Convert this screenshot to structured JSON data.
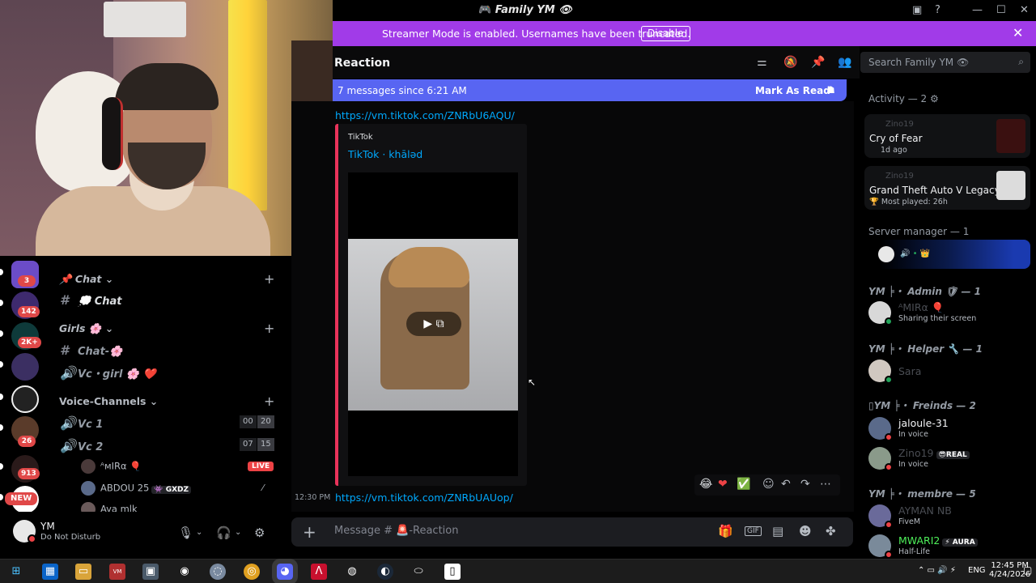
{
  "window": {
    "title": "Family YM",
    "title_icon": "gamepad-emoji"
  },
  "streamer": {
    "message": "Streamer Mode is enabled. Usernames have been truncated.",
    "button": "Disable"
  },
  "channel_header": {
    "name": "Reaction",
    "search_placeholder": "Search Family YM 👁"
  },
  "new_messages": {
    "text": "7 messages since 6:21 AM",
    "mark_read": "Mark As Read"
  },
  "messages": [
    {
      "link": "https://vm.tiktok.com/ZNRbU6AQU/",
      "embed": {
        "provider": "TikTok",
        "title": "TikTok · khāləd"
      }
    },
    {
      "time": "12:30 PM",
      "link": "https://vm.tiktok.com/ZNRbUAUop/"
    }
  ],
  "reactions": [
    "😂",
    "❤️",
    "✅"
  ],
  "composer": {
    "placeholder": "Message # 🚨-Reaction"
  },
  "guild_badges": [
    "3",
    "142",
    "2K+",
    "26",
    "913",
    "NEW"
  ],
  "channels": {
    "cat_chat": "📌 Chat ⌄",
    "chat": "💭 Chat",
    "cat_girls": "Girls 🌸 ⌄",
    "chat_girls": "Chat-🌸",
    "vc_girl": "Vc・girl 🌸 ❤️",
    "cat_voice": "Voice-Channels ⌄",
    "vc1": "Vc 1",
    "vc1_count": [
      "00",
      "20"
    ],
    "vc2": "Vc 2",
    "vc2_count": [
      "07",
      "15"
    ],
    "users": [
      {
        "name": "ᴬᴍIRα 🎈 ",
        "live": "LIVE"
      },
      {
        "name": "ABDOU 25",
        "tag": "👾 GXDZ"
      },
      {
        "name": "Aya mlk"
      }
    ]
  },
  "user": {
    "name": "YM",
    "status": "Do Not Disturb"
  },
  "members": {
    "activity_head": "Activity — 2 ⚙",
    "activity": [
      {
        "user": "Zino19",
        "game": "Cry of Fear",
        "time": "1d ago"
      },
      {
        "user": "Zino19",
        "game": "Grand Theft Auto V Legacy",
        "time": "🏆 Most played: 26h"
      }
    ],
    "server_manager_head": "Server manager — 1",
    "admin_head": "YM ╞・ Admin 🛡 — 1",
    "admin": {
      "name": "ᴬMIRα 🎈",
      "status": "Sharing their screen"
    },
    "helper_head": "YM ╞・ Helper 🔧 — 1",
    "helper": {
      "name": "Sara"
    },
    "friends_head": "▯YM ╞・ Freinds — 2",
    "friends": [
      {
        "name": "jaloule-31",
        "status": "In voice"
      },
      {
        "name": "Zino19",
        "tag": "😎REAL",
        "status": "In voice"
      }
    ],
    "membre_head": "YM ╞・ membre — 5",
    "membres": [
      {
        "name": "AYMAN NB",
        "status": "FiveM"
      },
      {
        "name": "MWARI2",
        "tag": "⚡ AURA",
        "status": "Half-Life"
      }
    ]
  },
  "taskbar": {
    "lang": "ENG",
    "time": "12:45 PM",
    "date": "4/24/2026"
  },
  "colors": {
    "accent": "#a13be8",
    "blurple": "#5865f2",
    "link": "#00a8fc",
    "embed_bar": "#e8335a",
    "dnd": "#ed4245",
    "online": "#23a55a"
  }
}
